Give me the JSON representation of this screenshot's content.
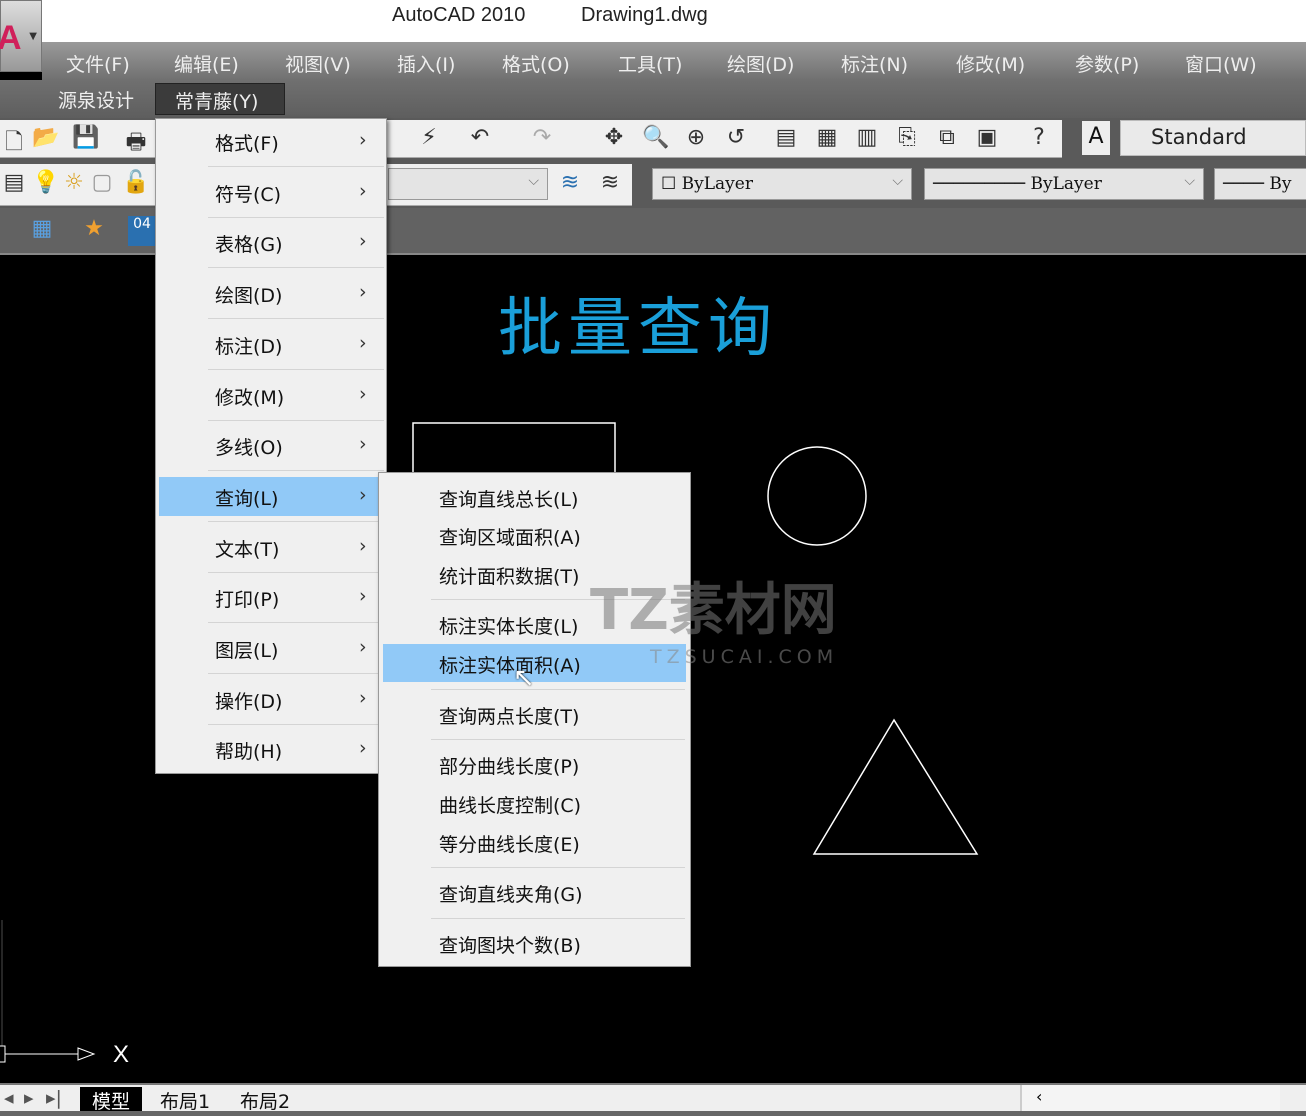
{
  "window": {
    "app_name": "AutoCAD 2010",
    "document": "Drawing1.dwg"
  },
  "menubar": [
    "文件(F)",
    "编辑(E)",
    "视图(V)",
    "插入(I)",
    "格式(O)",
    "工具(T)",
    "绘图(D)",
    "标注(N)",
    "修改(M)",
    "参数(P)",
    "窗口(W)"
  ],
  "menubar2": [
    "源泉设计",
    "常青藤(Y)"
  ],
  "toolbar": {
    "text_style": "Standard",
    "color_combo": "ByLayer",
    "linetype_combo": "ByLayer",
    "lineweight_combo": "By"
  },
  "main_menu": {
    "items": [
      "格式(F)",
      "符号(C)",
      "表格(G)",
      "绘图(D)",
      "标注(D)",
      "修改(M)",
      "多线(O)",
      "查询(L)",
      "文本(T)",
      "打印(P)",
      "图层(L)",
      "操作(D)",
      "帮助(H)"
    ],
    "selected": "查询(L)"
  },
  "submenu": {
    "items": [
      "查询直线总长(L)",
      "查询区域面积(A)",
      "统计面积数据(T)",
      "标注实体长度(L)",
      "标注实体面积(A)",
      "查询两点长度(T)",
      "部分曲线长度(P)",
      "曲线长度控制(C)",
      "等分曲线长度(E)",
      "查询直线夹角(G)",
      "查询图块个数(B)"
    ],
    "selected": "标注实体面积(A)"
  },
  "canvas": {
    "title_text": "批量查询",
    "ucs_x": "X",
    "text_color": "#1a9fd9"
  },
  "watermark": {
    "main": "TZ素材网",
    "url": "TZSUCAI.COM"
  },
  "tabs": [
    "模型",
    "布局1",
    "布局2"
  ],
  "colors": {
    "highlight": "#91c9f7",
    "menu_bg": "#f0f0f0"
  }
}
